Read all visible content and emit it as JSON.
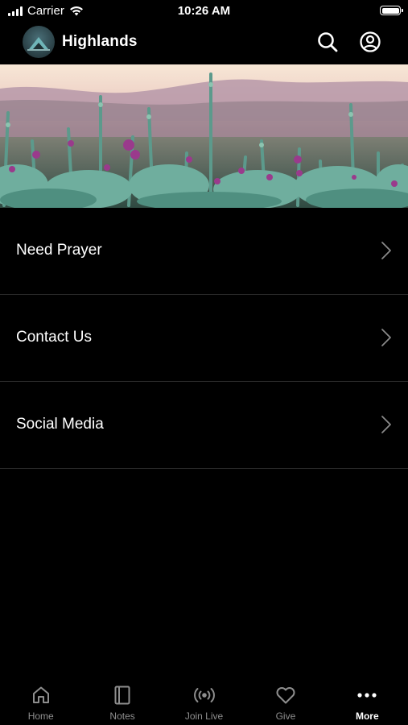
{
  "status_bar": {
    "carrier": "Carrier",
    "time": "10:26 AM"
  },
  "header": {
    "title": "Highlands"
  },
  "menu": [
    {
      "label": "Need Prayer"
    },
    {
      "label": "Contact Us"
    },
    {
      "label": "Social Media"
    }
  ],
  "tabs": [
    {
      "label": "Home",
      "icon": "home-icon"
    },
    {
      "label": "Notes",
      "icon": "notes-icon"
    },
    {
      "label": "Join Live",
      "icon": "broadcast-icon"
    },
    {
      "label": "Give",
      "icon": "heart-icon"
    },
    {
      "label": "More",
      "icon": "more-dots-icon",
      "active": true
    }
  ],
  "colors": {
    "background": "#000000",
    "text": "#ffffff",
    "tab_inactive": "#8e8e8e",
    "divider": "#2b2b2b"
  }
}
